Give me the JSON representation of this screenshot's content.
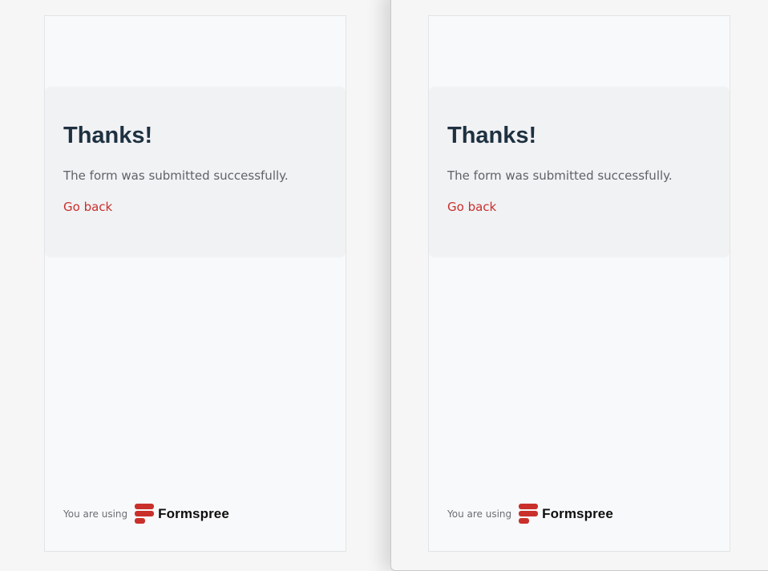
{
  "cards": [
    {
      "title": "Thanks!",
      "message": "The form was submitted successfully.",
      "back_link": "Go back",
      "footer_text": "You are using",
      "brand_name": "Formspree",
      "brand_icon": "formspree-logo-icon"
    },
    {
      "title": "Thanks!",
      "message": "The form was submitted successfully.",
      "back_link": "Go back",
      "footer_text": "You are using",
      "brand_name": "Formspree",
      "brand_icon": "formspree-logo-icon"
    }
  ],
  "colors": {
    "accent": "#c9302c",
    "heading": "#1e3140",
    "panel_background": "#f1f2f4",
    "card_background": "#f8f9fa"
  }
}
